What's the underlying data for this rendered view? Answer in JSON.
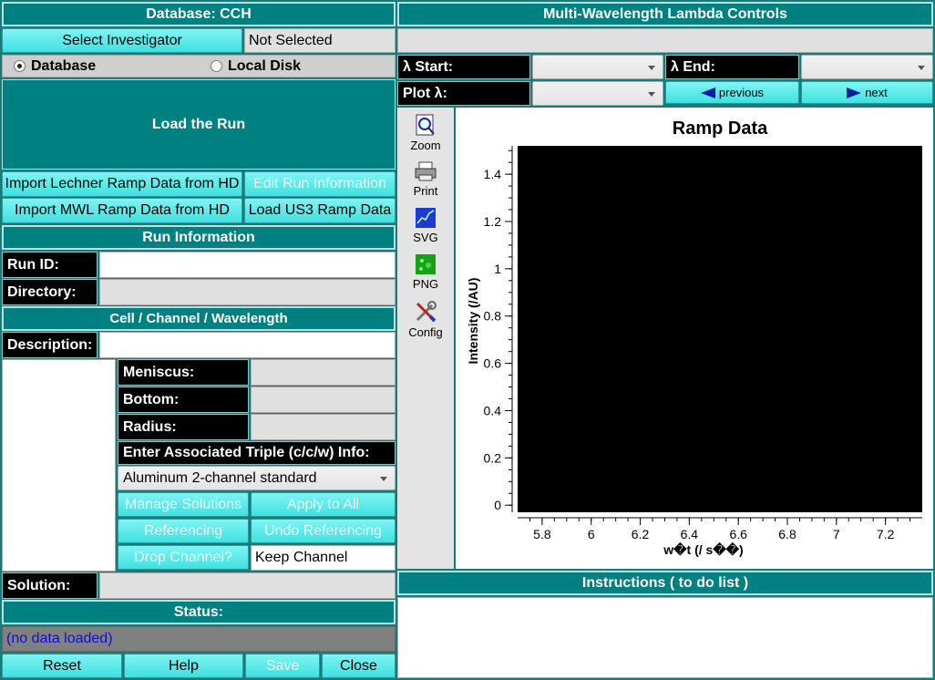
{
  "left": {
    "db_header": "Database: CCH",
    "select_investigator": "Select Investigator",
    "investigator_value": "Not Selected",
    "radio_database": "Database",
    "radio_local": "Local Disk",
    "load_run": "Load the Run",
    "import_lechner": "Import Lechner Ramp Data from HD",
    "edit_run": "Edit Run Information",
    "import_mwl": "Import MWL Ramp Data from HD",
    "load_us3": "Load US3 Ramp Data",
    "run_info_header": "Run Information",
    "run_id_label": "Run ID:",
    "run_id_value": "",
    "directory_label": "Directory:",
    "directory_value": "",
    "ccw_header": "Cell / Channel / Wavelength",
    "description_label": "Description:",
    "description_value": "",
    "meniscus_label": "Meniscus:",
    "bottom_label": "Bottom:",
    "radius_label": "Radius:",
    "triple_label": "Enter Associated Triple (c/c/w) Info:",
    "centerpiece": "Aluminum 2-channel standard",
    "manage_solutions": "Manage Solutions",
    "apply_all": "Apply to All",
    "referencing": "Referencing",
    "undo_referencing": "Undo Referencing",
    "drop_channel": "Drop Channel?",
    "keep_channel": "Keep Channel",
    "solution_label": "Solution:",
    "status_header": "Status:",
    "status_value": "(no data loaded)",
    "reset": "Reset",
    "help": "Help",
    "save": "Save",
    "close": "Close"
  },
  "right": {
    "mwl_header": "Multi-Wavelength Lambda Controls",
    "lambda_start": "λ Start:",
    "lambda_end": "λ End:",
    "plot_lambda": "Plot λ:",
    "previous": "previous",
    "next": "next",
    "instructions_header": "Instructions ( to do list )"
  },
  "toolbar": {
    "zoom": "Zoom",
    "print": "Print",
    "svg": "SVG",
    "png": "PNG",
    "config": "Config"
  },
  "chart_data": {
    "type": "line",
    "title": "Ramp Data",
    "xlabel": "w�t (/ s��)",
    "ylabel": "Intensity (/AU)",
    "xlim": [
      5.7,
      7.35
    ],
    "ylim": [
      -0.03,
      1.52
    ],
    "xticks": [
      5.8,
      6,
      6.2,
      6.4,
      6.6,
      6.8,
      7,
      7.2
    ],
    "xtick_labels": [
      "5.8",
      "6",
      "6.2",
      "6.4",
      "6.6",
      "6.8",
      "7",
      "7.2"
    ],
    "yticks": [
      0,
      0.2,
      0.4,
      0.6,
      0.8,
      1,
      1.2,
      1.4
    ],
    "ytick_labels": [
      "0",
      "0.2",
      "0.4",
      "0.6",
      "0.8",
      "1",
      "1.2",
      "1.4"
    ],
    "canvas_color": "#000000",
    "series": []
  }
}
